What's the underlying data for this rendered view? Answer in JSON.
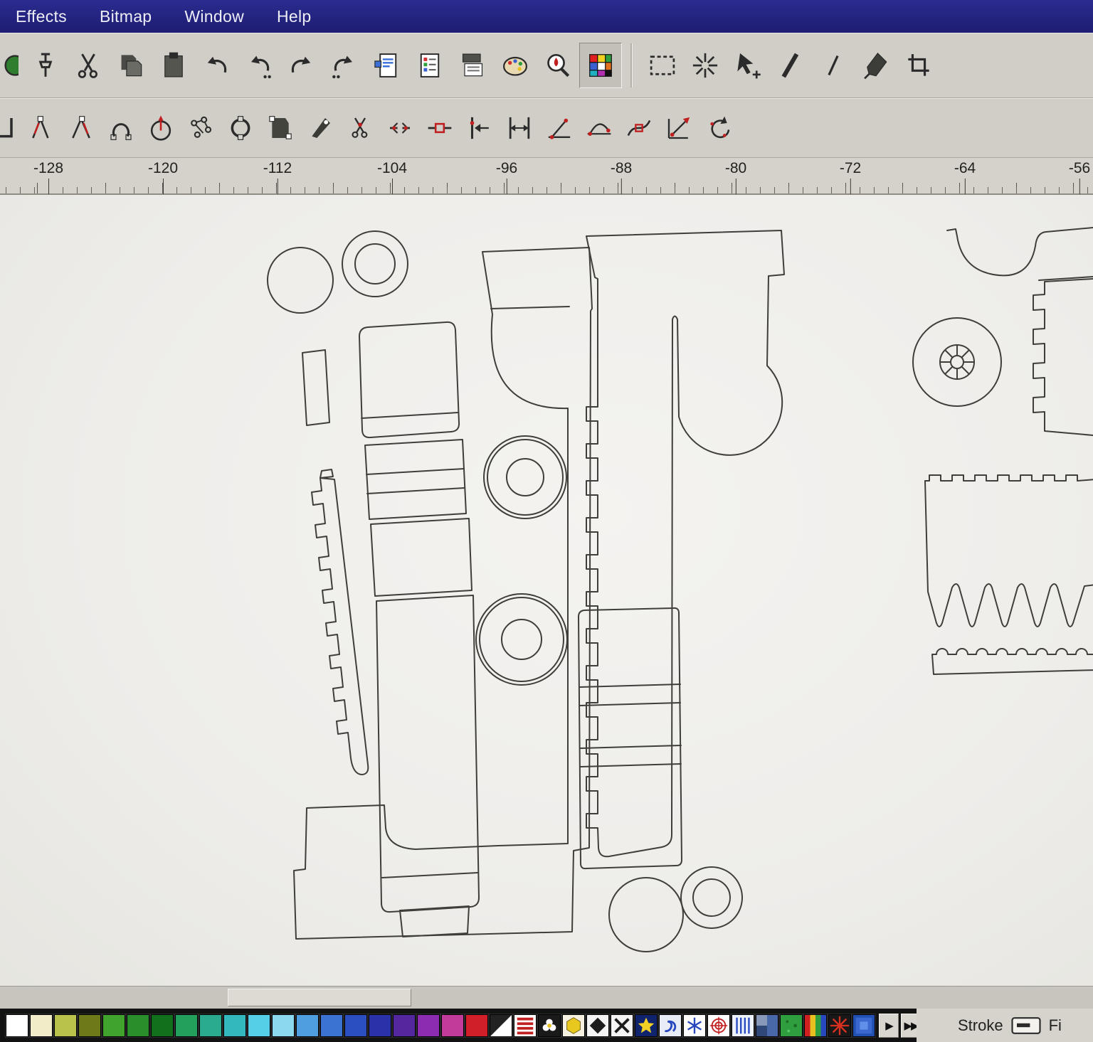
{
  "menu_bar": {
    "items": [
      "Effects",
      "Bitmap",
      "Window",
      "Help"
    ]
  },
  "toolbars": {
    "standard": {
      "icons": [
        "clipped-left-icon",
        "pin-icon",
        "cut-icon",
        "copy-icon",
        "paste-icon",
        "undo-icon",
        "undo-list-icon",
        "redo-icon",
        "redo-list-icon",
        "import-icon",
        "export-icon",
        "print-merge-icon",
        "palette-icon",
        "zoom-icon",
        "color-grid-icon",
        "separator",
        "marquee-icon",
        "wand-icon",
        "pick-plus-icon",
        "thick-line-icon",
        "thin-line-icon",
        "knife-icon",
        "crop-icon"
      ],
      "active_icon": "color-grid-icon"
    },
    "node_edit": {
      "icons": [
        "clipped-node-icon",
        "curve-handles-icon",
        "curve-handles-alt-icon",
        "horseshoe-curve-icon",
        "gauge-icon",
        "molecule-nodes-icon",
        "rotate-ring-icon",
        "dark-sheet-nodes-icon",
        "pen-nib-icon",
        "node-scissors-icon",
        "break-node-icon",
        "join-node-icon",
        "to-line-icon",
        "to-curve-icon",
        "cusp-node-icon",
        "smooth-node-icon",
        "symmetric-node-icon",
        "scale-nodes-icon",
        "rotate-nodes-icon"
      ]
    }
  },
  "ruler": {
    "unit_labels": [
      "-128",
      "-120",
      "-112",
      "-104",
      "-96",
      "-88",
      "-80",
      "-72",
      "-64",
      "-56"
    ]
  },
  "canvas": {
    "objects": [
      "circle-small",
      "ring-small",
      "bar-small",
      "grip-top-section",
      "grip-band-upper",
      "grip-band-lower",
      "grip-body",
      "serrated-strip",
      "washer-upper",
      "washer-lower",
      "boot-part-with-base",
      "t-bracket-with-notched-strip",
      "banded-rect-part",
      "circle-bottom",
      "ring-bottom",
      "arched-top-panel",
      "notched-side-panel",
      "spoke-wheel",
      "toothed-comb",
      "bump-strip"
    ]
  },
  "palette": {
    "colors": [
      "#ffffff",
      "#f2ecc8",
      "#b9c24a",
      "#6e7a1a",
      "#3fa32e",
      "#2a8f2a",
      "#11701c",
      "#23a05c",
      "#2aab8f",
      "#33b9bd",
      "#55cfe8",
      "#8bd8ef",
      "#4f9fe0",
      "#3a73d2",
      "#2b4fc0",
      "#2a32aa",
      "#55279e",
      "#8c2cb0",
      "#c23a9a",
      "#d01f28"
    ],
    "special_swatches": [
      "two-color-pattern-swatch",
      "full-color-pattern-swatch",
      "flower-pattern-swatch",
      "hexagon-pattern-swatch",
      "diamond-pattern-swatch",
      "cross-pattern-swatch",
      "star-pattern-swatch",
      "postscript-texture-swatch",
      "snowflake-pattern-swatch",
      "web-pattern-swatch",
      "lines-pattern-swatch",
      "texture-blue-gray-swatch",
      "texture-green-swatch",
      "texture-rainbow-swatch",
      "texture-starburst-swatch",
      "texture-blue-swatch"
    ],
    "scroll_buttons": [
      "▶",
      "▶▶"
    ]
  },
  "status_bar": {
    "stroke_label": "Stroke",
    "fill_label": "Fi"
  }
}
